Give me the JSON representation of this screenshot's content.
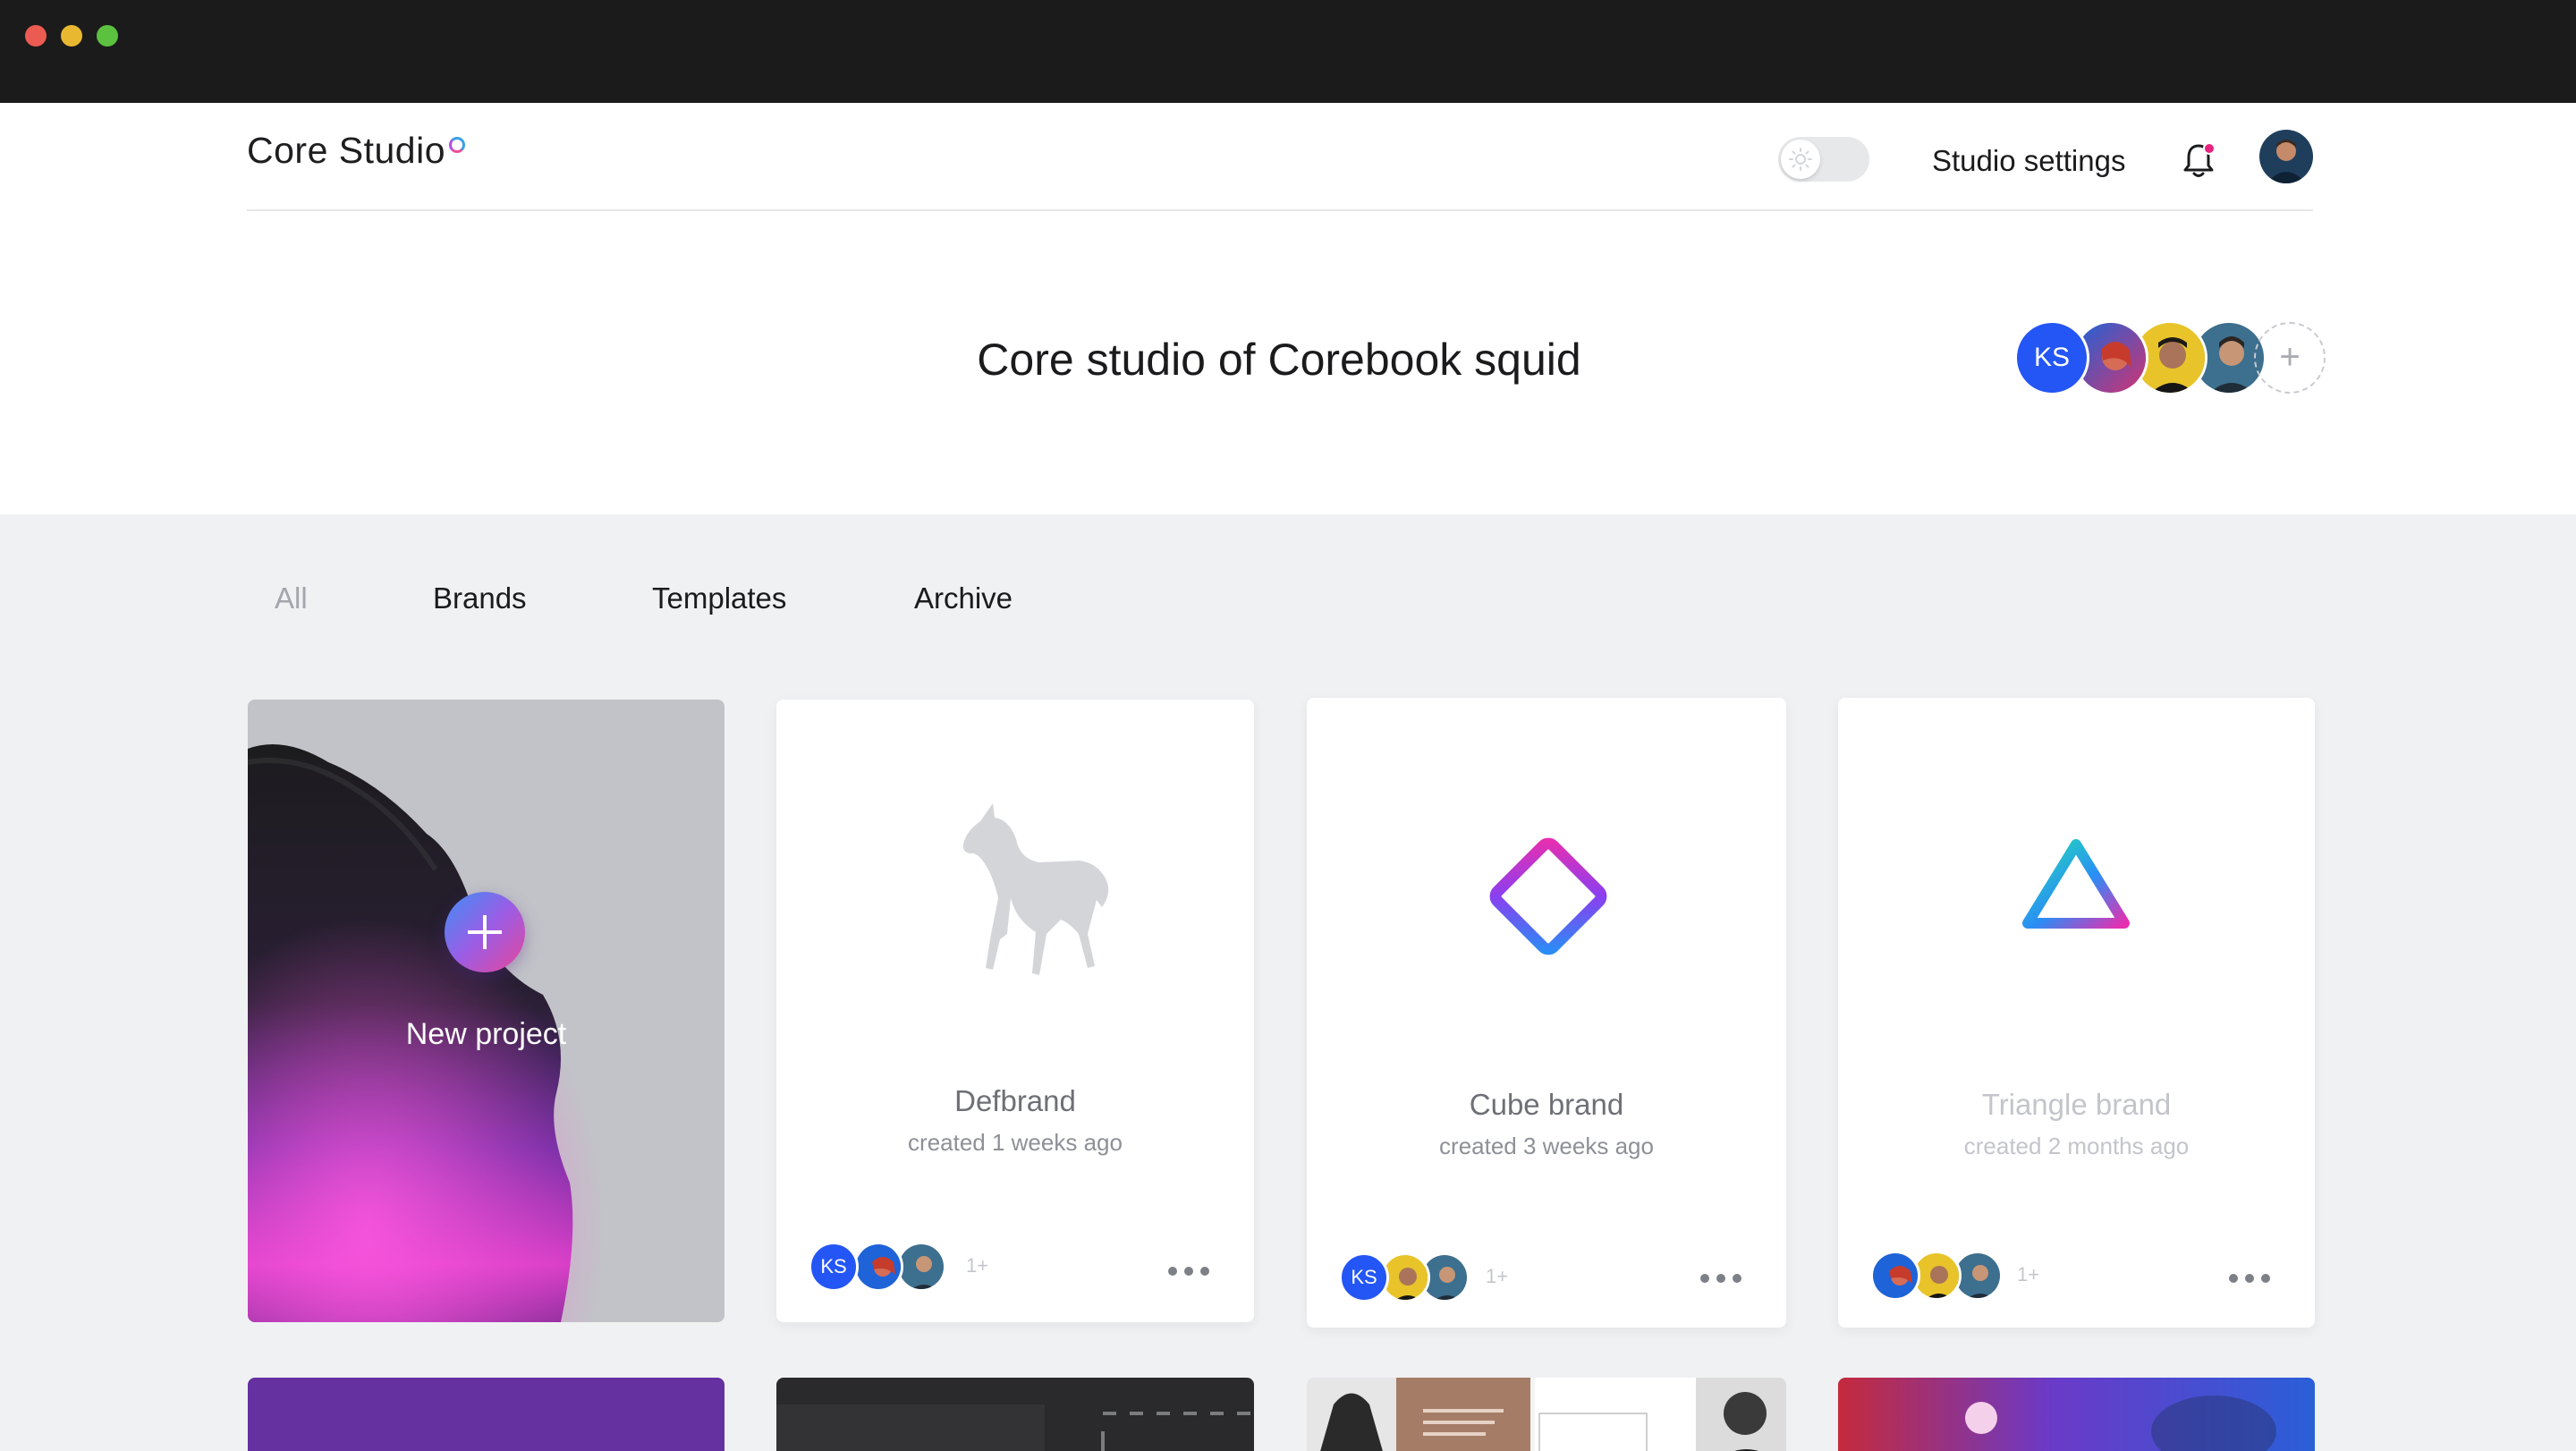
{
  "window": {
    "controls": [
      "close",
      "minimize",
      "maximize"
    ]
  },
  "header": {
    "logo_text": "Core Studio",
    "theme_toggle_icon": "sun-icon",
    "settings_label": "Studio settings",
    "notification_icon": "bell-icon",
    "studio_title": "Core studio of Corebook squid",
    "members": [
      "KS"
    ],
    "add_member_symbol": "+"
  },
  "tabs": [
    {
      "label": "All",
      "active": true
    },
    {
      "label": "Brands",
      "active": false
    },
    {
      "label": "Templates",
      "active": false
    },
    {
      "label": "Archive",
      "active": false
    }
  ],
  "new_project": {
    "label": "New project",
    "icon": "plus-icon"
  },
  "projects": [
    {
      "title": "Defbrand",
      "created": "created 1 weeks ago",
      "avatar_initials": "KS",
      "extra_members": "1+",
      "logo": "horse-logo"
    },
    {
      "title": "Cube brand",
      "created": "created 3 weeks ago",
      "avatar_initials": "KS",
      "extra_members": "1+",
      "logo": "diamond-logo"
    },
    {
      "title": "Triangle brand",
      "created": "created 2 months ago",
      "extra_members": "1+",
      "logo": "triangle-logo"
    }
  ],
  "colors": {
    "accent_blue": "#2456f5",
    "notification_pink": "#e8237e",
    "chrome_dark": "#1b1b1b",
    "page_background": "#f0f1f3"
  }
}
